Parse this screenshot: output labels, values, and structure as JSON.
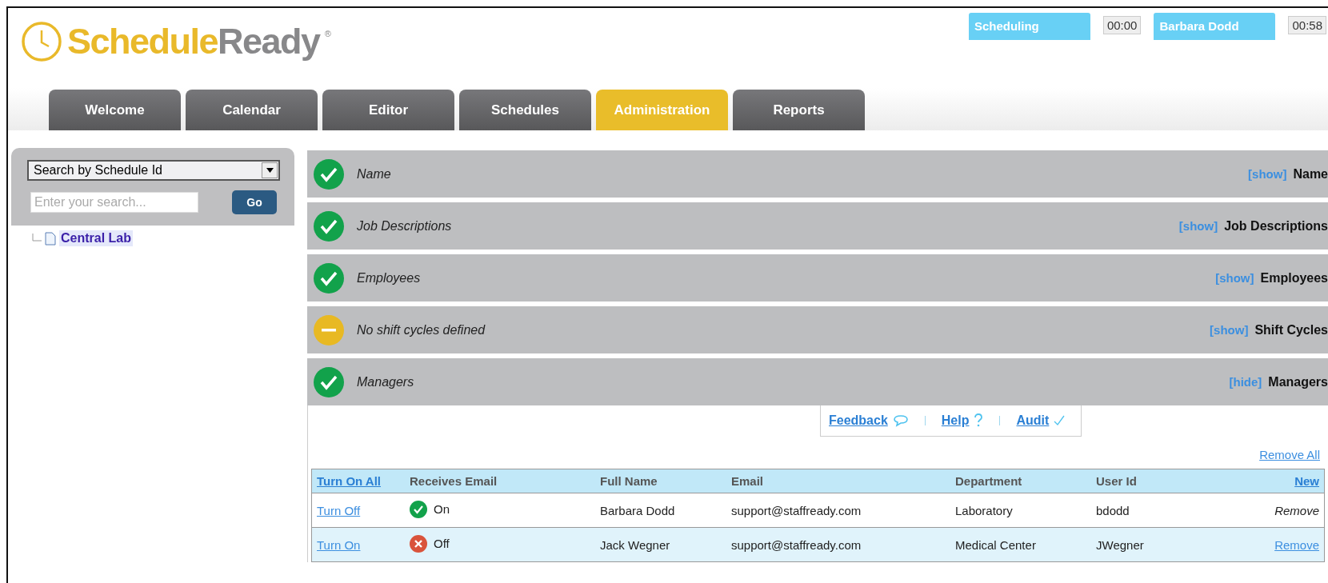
{
  "logo": {
    "part_1": "Schedule",
    "part_2": "Ready",
    "mark": "®"
  },
  "status": [
    {
      "label": "Scheduling",
      "time": "00:00"
    },
    {
      "label": "Barbara Dodd",
      "time": "00:58"
    }
  ],
  "tabs": [
    {
      "label": "Welcome",
      "selected": false
    },
    {
      "label": "Calendar",
      "selected": false
    },
    {
      "label": "Editor",
      "selected": false
    },
    {
      "label": "Schedules",
      "selected": false
    },
    {
      "label": "Administration",
      "selected": true
    },
    {
      "label": "Reports",
      "selected": false
    }
  ],
  "search": {
    "mode": "Search by Schedule Id",
    "placeholder": "Enter your search...",
    "button": "Go"
  },
  "tree": [
    {
      "label": "Central Lab",
      "selected": true
    }
  ],
  "sections": [
    {
      "kind": "complete",
      "summary": "Name",
      "toggle": "[show]",
      "title": "Name"
    },
    {
      "kind": "complete",
      "summary": "Job Descriptions",
      "toggle": "[show]",
      "title": "Job Descriptions"
    },
    {
      "kind": "complete",
      "summary": "Employees",
      "toggle": "[show]",
      "title": "Employees"
    },
    {
      "kind": "pending",
      "summary": "No shift cycles defined",
      "toggle": "[show]",
      "title": "Shift Cycles"
    },
    {
      "kind": "complete",
      "summary": "Managers",
      "toggle": "[hide]",
      "title": "Managers"
    }
  ],
  "links": [
    {
      "label": "Feedback",
      "kind": "feedback"
    },
    {
      "label": "Help",
      "kind": "help"
    },
    {
      "label": "Audit",
      "kind": "audit"
    }
  ],
  "remove_all": "Remove All",
  "table": {
    "turn_on_all": "Turn On All",
    "columns": [
      "Receives Email",
      "Full Name",
      "Email",
      "Department",
      "User Id"
    ],
    "new": "New",
    "rows": [
      {
        "toggle": "Turn Off",
        "on": true,
        "email_state": "On",
        "name": "Barbara Dodd",
        "email": "support@staffready.com",
        "department": "Laboratory",
        "user_id": "bdodd",
        "remove": "Remove",
        "remove_disabled": true
      },
      {
        "toggle": "Turn On",
        "on": false,
        "email_state": "Off",
        "name": "Jack Wegner",
        "email": "support@staffready.com",
        "department": "Medical Center",
        "user_id": "JWegner",
        "remove": "Remove",
        "remove_disabled": false
      }
    ]
  }
}
